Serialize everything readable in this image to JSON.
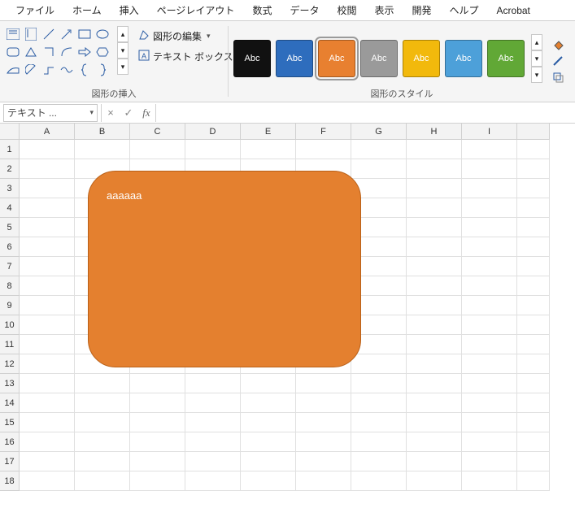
{
  "tabs": {
    "file": "ファイル",
    "home": "ホーム",
    "insert": "挿入",
    "pagelayout": "ページレイアウト",
    "formulas": "数式",
    "data": "データ",
    "review": "校閲",
    "view": "表示",
    "developer": "開発",
    "help": "ヘルプ",
    "acrobat": "Acrobat"
  },
  "ribbon": {
    "shapes_group_label": "図形の挿入",
    "styles_group_label": "図形のスタイル",
    "edit_shape_label": "図形の編集",
    "textbox_label": "テキスト ボックス",
    "swatch_text": "Abc"
  },
  "formula_bar": {
    "namebox": "テキスト ...",
    "cancel": "×",
    "enter": "✓",
    "fx": "fx",
    "value": ""
  },
  "columns": [
    "A",
    "B",
    "C",
    "D",
    "E",
    "F",
    "G",
    "H",
    "I"
  ],
  "rows": [
    "1",
    "2",
    "3",
    "4",
    "5",
    "6",
    "7",
    "8",
    "9",
    "10",
    "11",
    "12",
    "13",
    "14",
    "15",
    "16",
    "17",
    "18"
  ],
  "shape": {
    "text": "aaaaaa"
  }
}
